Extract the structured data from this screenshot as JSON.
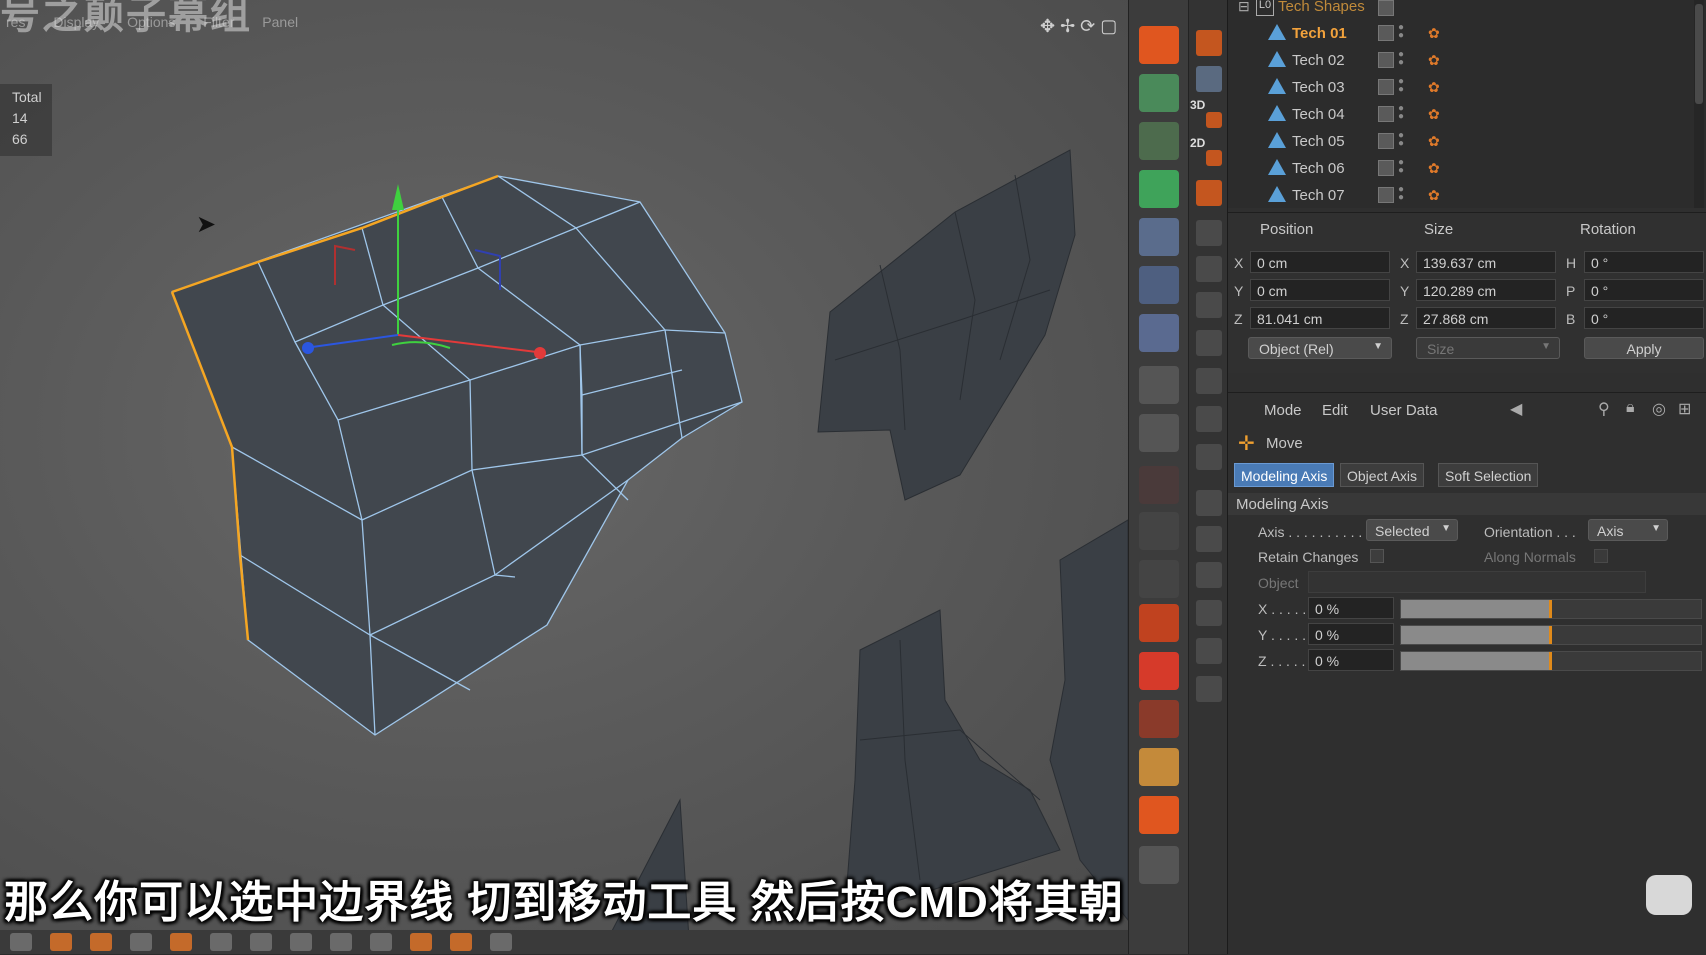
{
  "watermark": "号之颠子幕组",
  "viewport_menu": [
    "res",
    "Display",
    "Options",
    "Filter",
    "Panel"
  ],
  "hud": {
    "label": "Total",
    "values": [
      "14",
      "66"
    ]
  },
  "subtitle": "那么你可以选中边界线 切到移动工具  然后按CMD将其朝外复制",
  "toolbar_labels": {
    "3d": "3D",
    "2d": "2D"
  },
  "object_manager": {
    "parent": "Tech Shapes",
    "items": [
      {
        "label": "Tech 01",
        "selected": true
      },
      {
        "label": "Tech 02",
        "selected": false
      },
      {
        "label": "Tech 03",
        "selected": false
      },
      {
        "label": "Tech 04",
        "selected": false
      },
      {
        "label": "Tech 05",
        "selected": false
      },
      {
        "label": "Tech 06",
        "selected": false
      },
      {
        "label": "Tech 07",
        "selected": false
      }
    ]
  },
  "coordinates": {
    "headers": {
      "position": "Position",
      "size": "Size",
      "rotation": "Rotation"
    },
    "position": [
      {
        "axis": "X",
        "value": "0 cm"
      },
      {
        "axis": "Y",
        "value": "0 cm"
      },
      {
        "axis": "Z",
        "value": "81.041 cm"
      }
    ],
    "size": [
      {
        "axis": "X",
        "value": "139.637 cm"
      },
      {
        "axis": "Y",
        "value": "120.289 cm"
      },
      {
        "axis": "Z",
        "value": "27.868 cm"
      }
    ],
    "rotation": [
      {
        "axis": "H",
        "value": "0 °"
      },
      {
        "axis": "P",
        "value": "0 °"
      },
      {
        "axis": "B",
        "value": "0 °"
      }
    ],
    "mode_select": "Object (Rel)",
    "size_select": "Size",
    "apply": "Apply"
  },
  "attributes": {
    "menu": [
      "Mode",
      "Edit",
      "User Data"
    ],
    "tool": "Move",
    "tabs": [
      {
        "label": "Modeling Axis",
        "active": true
      },
      {
        "label": "Object Axis",
        "active": false
      },
      {
        "label": "Soft Selection",
        "active": false
      }
    ],
    "section_title": "Modeling Axis",
    "axis_label": "Axis . . . . . . . . . . .",
    "axis_value": "Selected",
    "orientation_label": "Orientation . . .",
    "orientation_value": "Axis",
    "retain_changes": "Retain Changes",
    "along_normals": "Along Normals",
    "object_label": "Object",
    "sliders": [
      {
        "label": "X . . . . .",
        "value": "0 %",
        "fraction": 0.5
      },
      {
        "label": "Y . . . . .",
        "value": "0 %",
        "fraction": 0.5
      },
      {
        "label": "Z . . . . .",
        "value": "0 %",
        "fraction": 0.5
      }
    ]
  },
  "colors": {
    "accent_orange": "#f2a23c",
    "selection_blue": "#4a7bb6",
    "edge_highlight": "#f5a623"
  }
}
